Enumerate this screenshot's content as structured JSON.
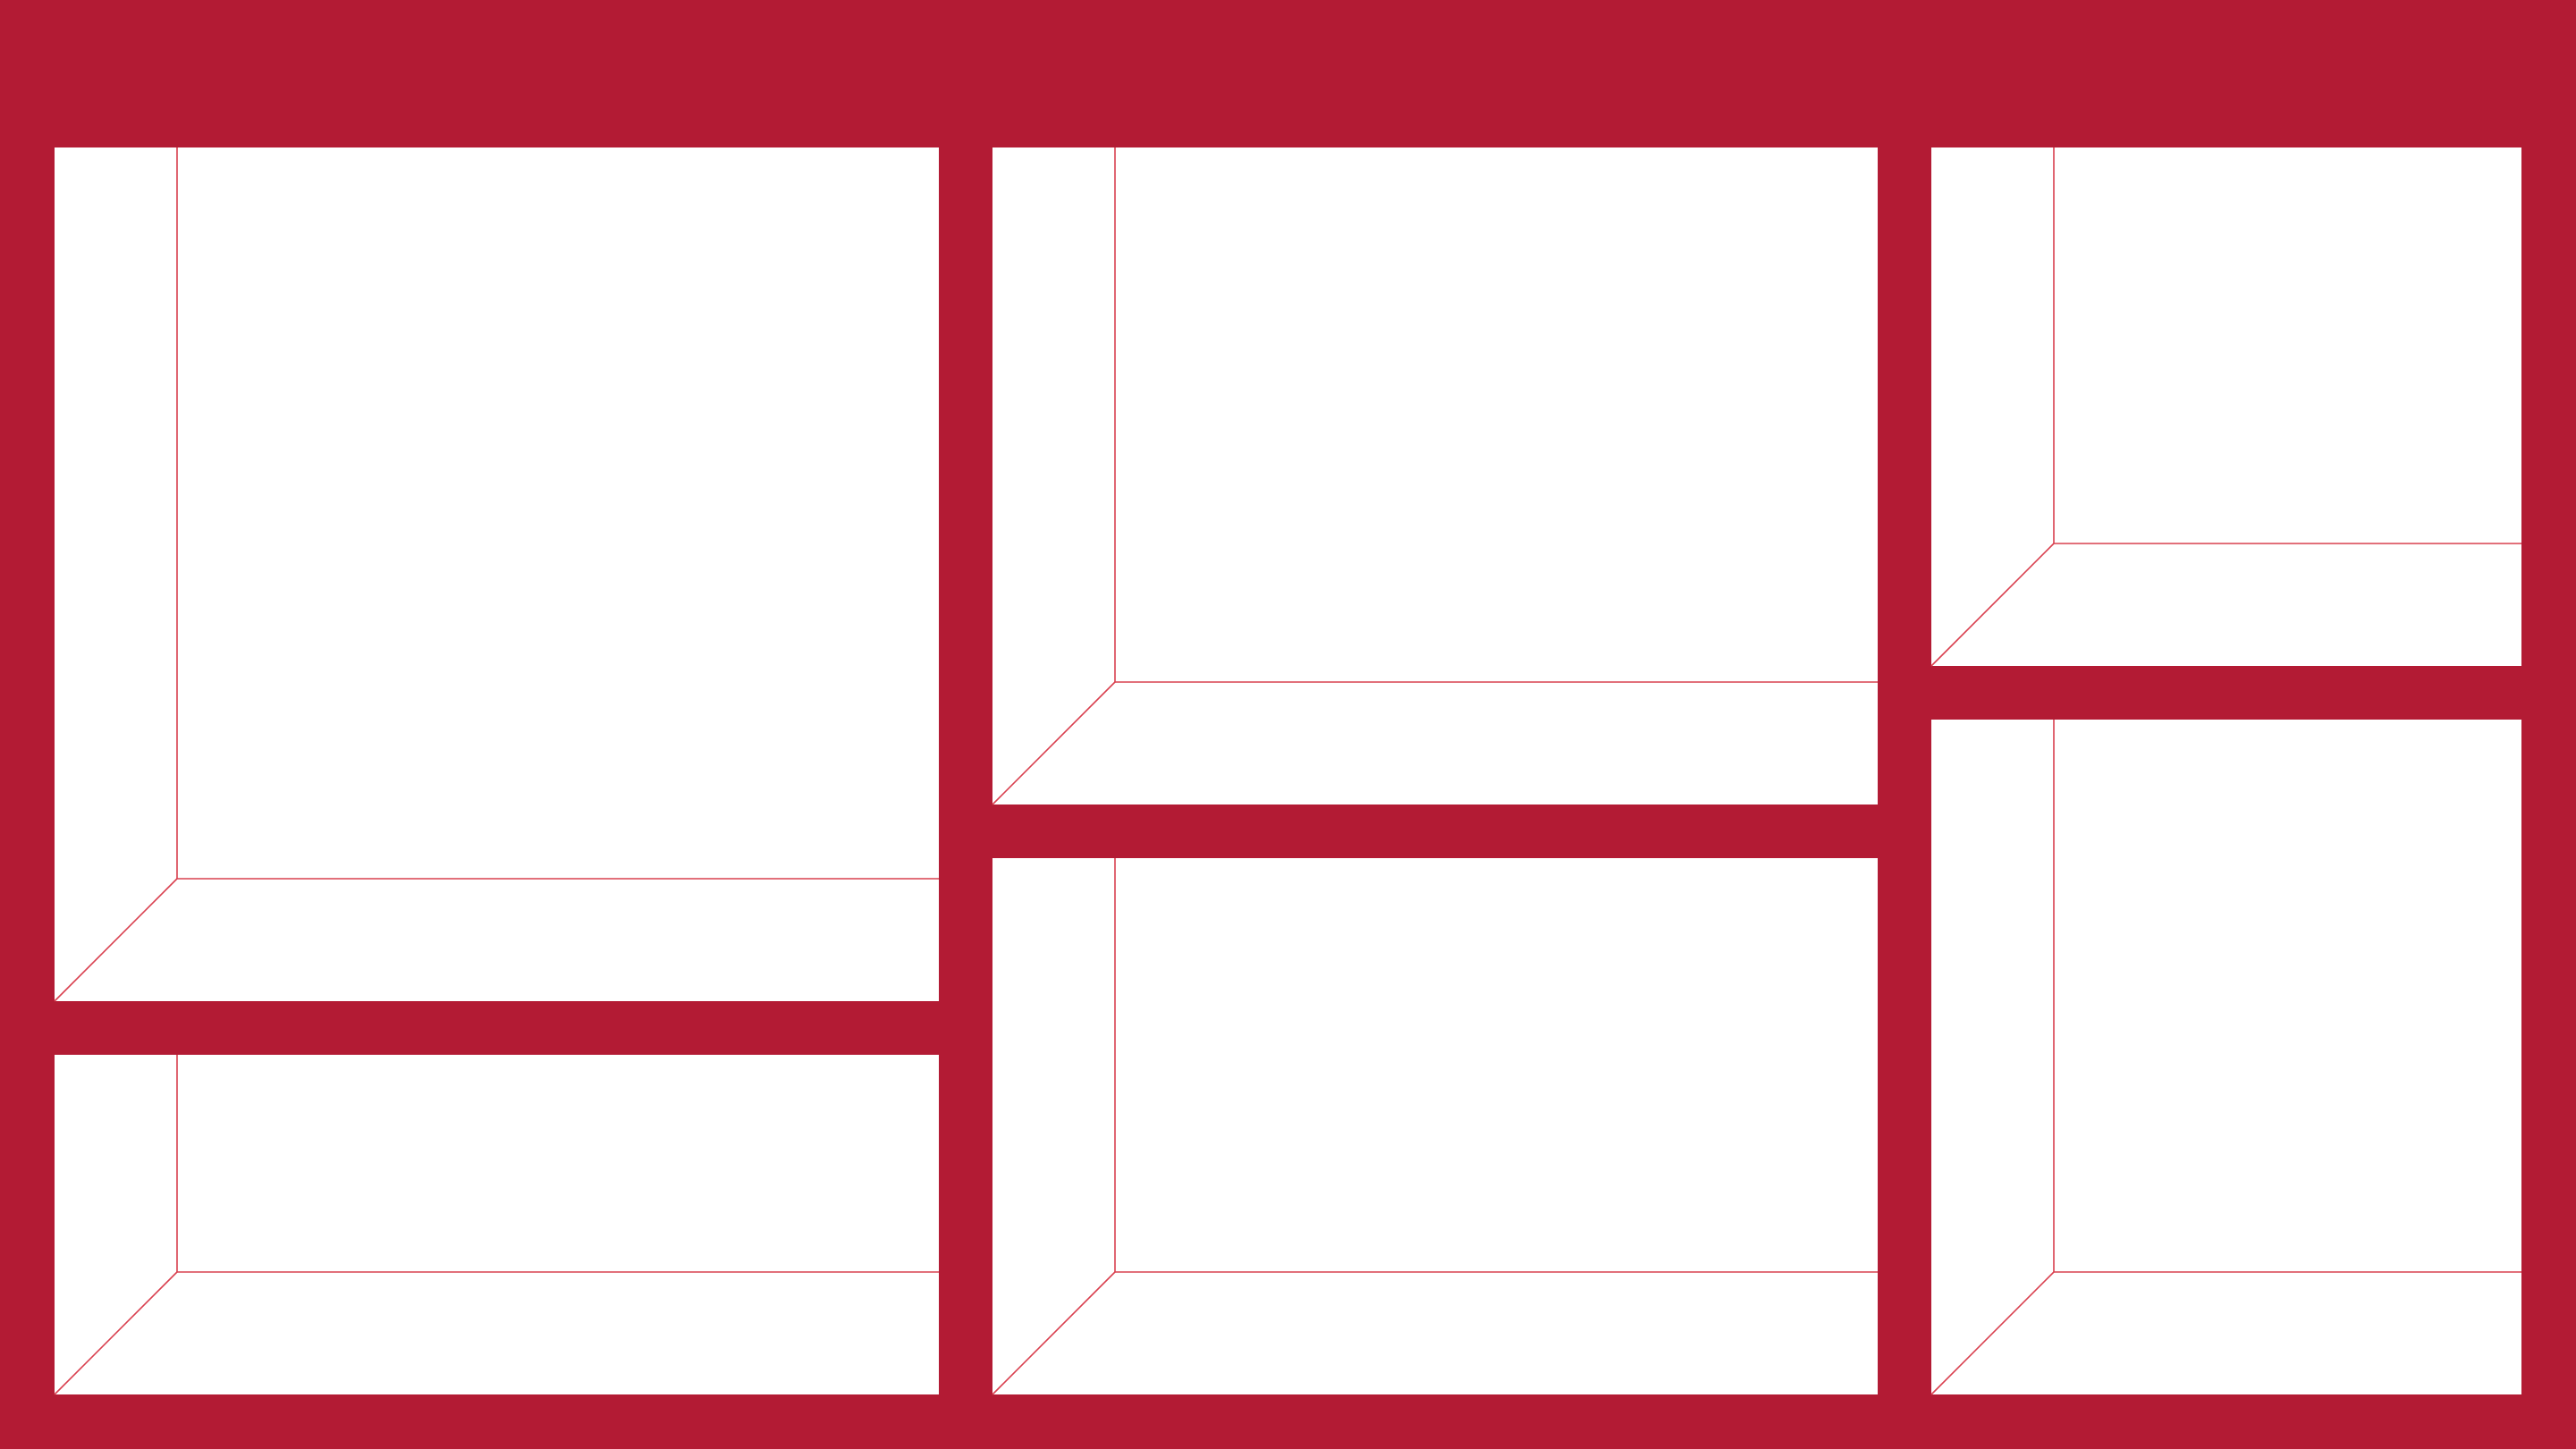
{
  "colors": {
    "frame": "#B31B34",
    "compartment_fill": "#FFFFFF",
    "edge_line": "#D9404F"
  },
  "shelving_unit": {
    "columns": 3,
    "compartments": [
      {
        "id": "left-upper",
        "column": 1,
        "row": 1
      },
      {
        "id": "left-lower",
        "column": 1,
        "row": 2
      },
      {
        "id": "middle-upper",
        "column": 2,
        "row": 1
      },
      {
        "id": "middle-lower",
        "column": 2,
        "row": 2
      },
      {
        "id": "right-upper",
        "column": 3,
        "row": 1
      },
      {
        "id": "right-lower",
        "column": 3,
        "row": 2
      }
    ]
  }
}
